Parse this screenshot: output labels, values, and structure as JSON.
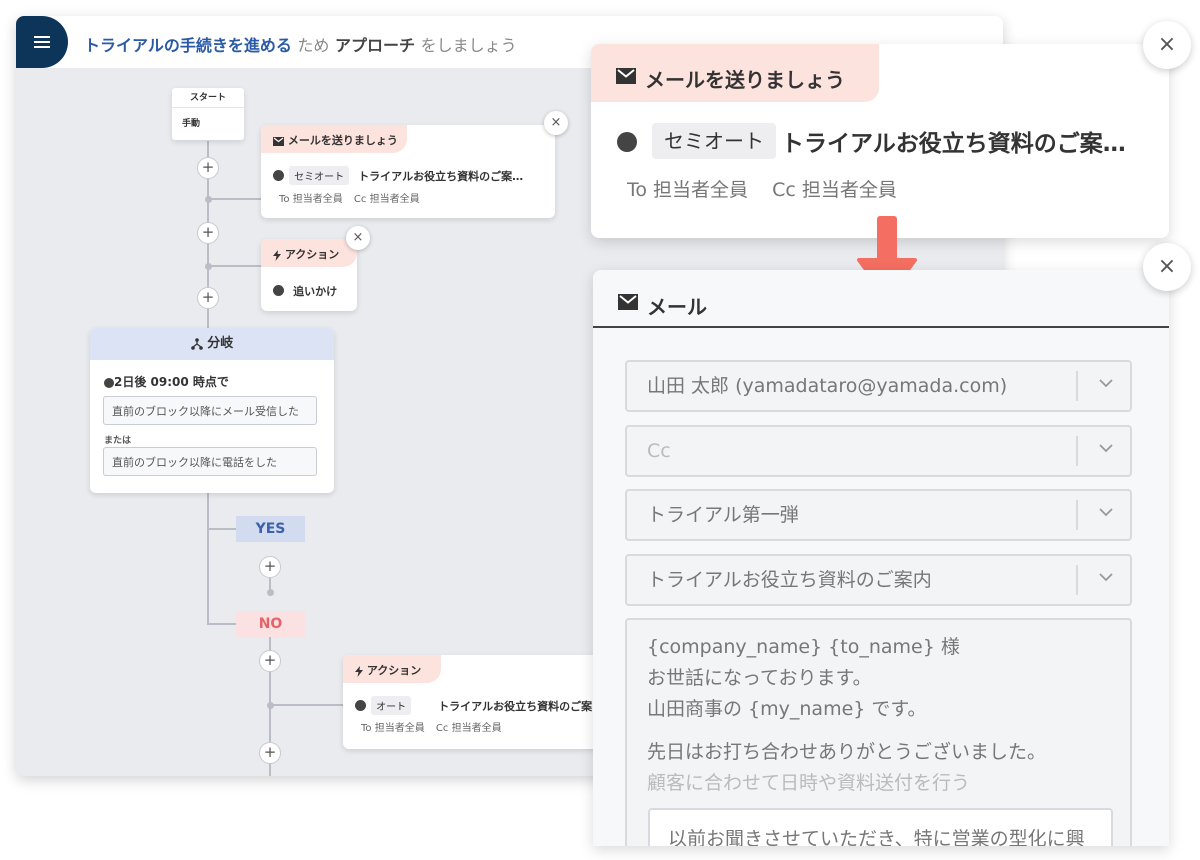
{
  "header": {
    "title_goal": "トライアルの手続きを進める",
    "title_for": "ため",
    "title_approach": "アプローチ",
    "title_suffix": "をしましょう"
  },
  "flow": {
    "start_title": "スタート",
    "start_sub": "手動",
    "plus": "+",
    "mail_node": {
      "tab": "メールを送りましょう",
      "mode": "セミオート",
      "subject": "トライアルお役立ち資料のご案…",
      "to": "To 担当者全員",
      "cc": "Cc 担当者全員"
    },
    "action_node": {
      "tab": "アクション",
      "label": "追いかけ"
    },
    "branch_node": {
      "title": "分岐",
      "condition": "2日後 09:00 時点で",
      "cond1": "直前のブロック以降にメール受信した",
      "or": "または",
      "cond2": "直前のブロック以降に電話をした"
    },
    "yes": "YES",
    "no": "NO",
    "action_node2": {
      "tab": "アクション",
      "mode": "オート",
      "subject": "トライアルお役立ち資料のご案",
      "to": "To 担当者全員",
      "cc": "Cc 担当者全員"
    },
    "close": "×"
  },
  "mail_card": {
    "tab": "メールを送りましょう",
    "mode": "セミオート",
    "subject": "トライアルお役立ち資料のご案…",
    "to": "To 担当者全員",
    "cc": "Cc 担当者全員",
    "close": "×"
  },
  "mail_panel": {
    "title": "メール",
    "close": "×",
    "from": "山田 太郎 (yamadataro@yamada.com)",
    "cc_placeholder": "Cc",
    "template": "トライアル第一弾",
    "subject": "トライアルお役立ち資料のご案内",
    "body_line1": "{company_name} {to_name} 様",
    "body_line2": "お世話になっております。",
    "body_line3": "山田商事の {my_name} です。",
    "body_line4": "先日はお打ち合わせありがとうございました。",
    "body_hint": "顧客に合わせて日時や資料送付を行う",
    "body_quote": "以前お聞きさせていただき、特に営業の型化に興"
  },
  "colors": {
    "navy": "#0d3559",
    "tab_pink": "#fde3de",
    "arrow": "#f46e62",
    "yes_bg": "#d3dbf1",
    "no_bg": "#fbe1e1"
  },
  "icons": [
    "menu-icon",
    "envelope-icon",
    "lightning-icon",
    "branch-icon",
    "close-icon",
    "chevron-down-icon",
    "down-arrow-icon"
  ]
}
